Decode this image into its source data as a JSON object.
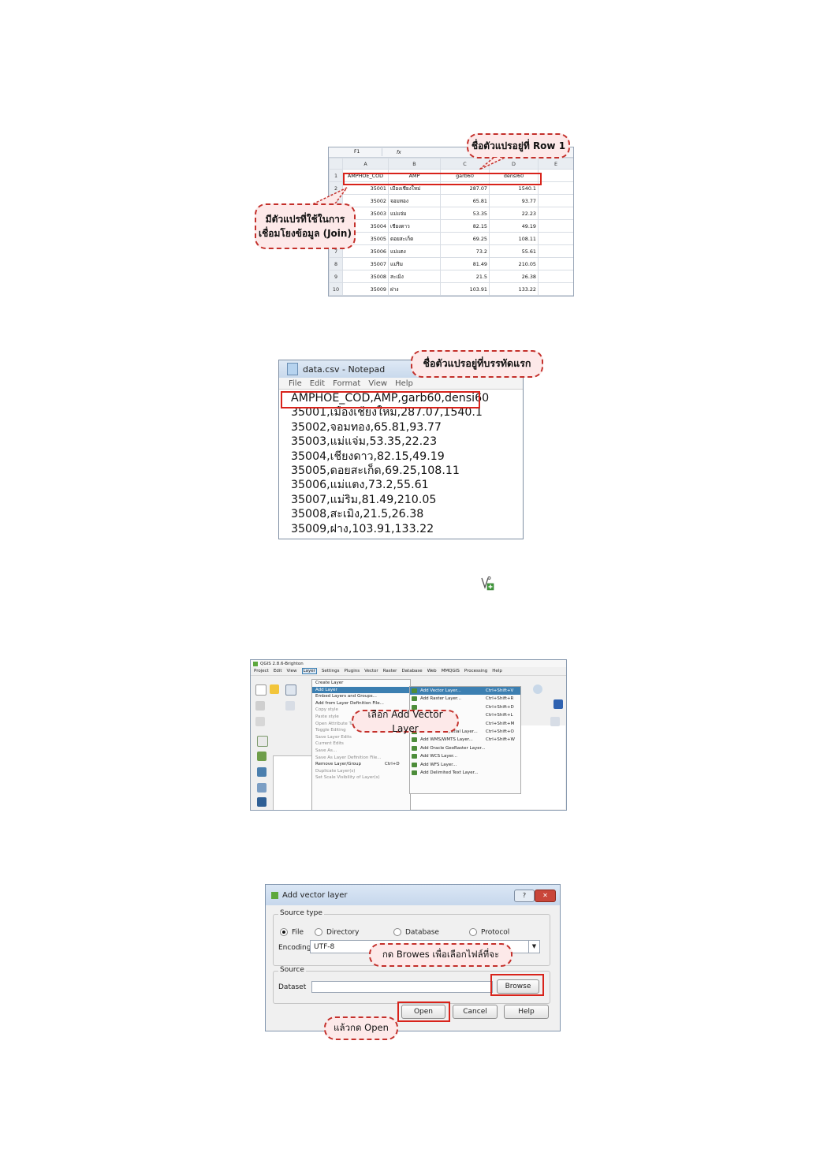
{
  "excel": {
    "namebox": "F1",
    "fx": "fx",
    "columns": [
      "",
      "A",
      "B",
      "C",
      "D",
      "E"
    ],
    "rows": [
      {
        "n": "1",
        "a": "AMPHOE_COD",
        "b": "AMP",
        "c": "garb60",
        "d": "densi60"
      },
      {
        "n": "2",
        "a": "35001",
        "b": "เมืองเชียงใหม่",
        "c": "287.07",
        "d": "1540.1"
      },
      {
        "n": "3",
        "a": "35002",
        "b": "จอมทอง",
        "c": "65.81",
        "d": "93.77"
      },
      {
        "n": "4",
        "a": "35003",
        "b": "แม่แจ่ม",
        "c": "53.35",
        "d": "22.23"
      },
      {
        "n": "5",
        "a": "35004",
        "b": "เชียงดาว",
        "c": "82.15",
        "d": "49.19"
      },
      {
        "n": "6",
        "a": "35005",
        "b": "ดอยสะเก็ด",
        "c": "69.25",
        "d": "108.11"
      },
      {
        "n": "7",
        "a": "35006",
        "b": "แม่แตง",
        "c": "73.2",
        "d": "55.61"
      },
      {
        "n": "8",
        "a": "35007",
        "b": "แม่ริม",
        "c": "81.49",
        "d": "210.05"
      },
      {
        "n": "9",
        "a": "35008",
        "b": "สะเมิง",
        "c": "21.5",
        "d": "26.38"
      },
      {
        "n": "10",
        "a": "35009",
        "b": "ฝาง",
        "c": "103.91",
        "d": "133.22"
      }
    ],
    "callout_row1": "ชื่อตัวแปรอยู่ที่ Row 1",
    "callout_join_line1": "มีตัวแปรที่ใช้ในการ",
    "callout_join_line2": "เชื่อมโยงข้อมูล (Join)"
  },
  "notepad": {
    "title": "data.csv - Notepad",
    "menu": [
      "File",
      "Edit",
      "Format",
      "View",
      "Help"
    ],
    "lines": [
      "AMPHOE_COD,AMP,garb60,densi60",
      "35001,เมืองเชียงใหม่,287.07,1540.1",
      "35002,จอมทอง,65.81,93.77",
      "35003,แม่แจ่ม,53.35,22.23",
      "35004,เชียงดาว,82.15,49.19",
      "35005,ดอยสะเก็ด,69.25,108.11",
      "35006,แม่แตง,73.2,55.61",
      "35007,แม่ริม,81.49,210.05",
      "35008,สะเมิง,21.5,26.38",
      "35009,ฝาง,103.91,133.22"
    ],
    "callout": "ชื่อตัวแปรอยู่ที่บรรทัดแรก"
  },
  "standalone_icon": "add-vector-layer-icon",
  "qgis": {
    "title": "QGIS 2.8.6-Brighton",
    "menubar": [
      "Project",
      "Edit",
      "View",
      "Layer",
      "Settings",
      "Plugins",
      "Vector",
      "Raster",
      "Database",
      "Web",
      "MMQGIS",
      "Processing",
      "Help"
    ],
    "layer_menu": [
      {
        "label": "Create Layer",
        "shortcut": "",
        "state": "normal"
      },
      {
        "label": "Add Layer",
        "shortcut": "",
        "state": "highlight"
      },
      {
        "label": "Embed Layers and Groups...",
        "shortcut": "",
        "state": "normal"
      },
      {
        "label": "Add from Layer Definition File...",
        "shortcut": "",
        "state": "normal"
      },
      {
        "label": "Copy style",
        "shortcut": "",
        "state": "disabled"
      },
      {
        "label": "Paste style",
        "shortcut": "",
        "state": "disabled"
      },
      {
        "label": "Open Attribute Table",
        "shortcut": "",
        "state": "disabled"
      },
      {
        "label": "Toggle Editing",
        "shortcut": "",
        "state": "disabled"
      },
      {
        "label": "Save Layer Edits",
        "shortcut": "",
        "state": "disabled"
      },
      {
        "label": "Current Edits",
        "shortcut": "",
        "state": "disabled"
      },
      {
        "label": "Save As...",
        "shortcut": "",
        "state": "disabled"
      },
      {
        "label": "Save As Layer Definition File...",
        "shortcut": "",
        "state": "disabled"
      },
      {
        "label": "Remove Layer/Group",
        "shortcut": "Ctrl+D",
        "state": "normal"
      },
      {
        "label": "Duplicate Layer(s)",
        "shortcut": "",
        "state": "disabled"
      },
      {
        "label": "Set Scale Visibility of Layer(s)",
        "shortcut": "",
        "state": "disabled"
      }
    ],
    "add_layer_submenu": [
      {
        "label": "Add Vector Layer...",
        "shortcut": "Ctrl+Shift+V",
        "state": "highlight"
      },
      {
        "label": "Add Raster Layer...",
        "shortcut": "Ctrl+Shift+R",
        "state": "normal"
      },
      {
        "label": "",
        "shortcut": "Ctrl+Shift+D",
        "state": "normal"
      },
      {
        "label": "",
        "shortcut": "Ctrl+Shift+L",
        "state": "normal"
      },
      {
        "label": "",
        "shortcut": "Ctrl+Shift+M",
        "state": "normal"
      },
      {
        "label": "Add Oracle Spatial Layer...",
        "shortcut": "Ctrl+Shift+O",
        "state": "normal"
      },
      {
        "label": "Add WMS/WMTS Layer...",
        "shortcut": "Ctrl+Shift+W",
        "state": "normal"
      },
      {
        "label": "Add Oracle GeoRaster Layer...",
        "shortcut": "",
        "state": "normal"
      },
      {
        "label": "Add WCS Layer...",
        "shortcut": "",
        "state": "normal"
      },
      {
        "label": "Add WFS Layer...",
        "shortcut": "",
        "state": "normal"
      },
      {
        "label": "Add Delimited Text Layer...",
        "shortcut": "",
        "state": "normal"
      }
    ],
    "callout": "เลือก Add Vector Layer",
    "colors": {
      "highlight": "#3c7fb1"
    }
  },
  "dialog": {
    "title": "Add vector layer",
    "help_glyph": "?",
    "close_glyph": "✕",
    "source_type_label": "Source type",
    "radios": [
      {
        "label": "File",
        "checked": true
      },
      {
        "label": "Directory",
        "checked": false
      },
      {
        "label": "Database",
        "checked": false
      },
      {
        "label": "Protocol",
        "checked": false
      }
    ],
    "encoding_label": "Encoding",
    "encoding_value": "UTF-8",
    "source_label": "Source",
    "dataset_label": "Dataset",
    "dataset_value": "",
    "browse_label": "Browse",
    "open_label": "Open",
    "cancel_label": "Cancel",
    "help_label": "Help",
    "callout_browse": "กด Browes เพื่อเลือกไฟล์ที่จะ",
    "callout_open": "แล้วกด Open"
  }
}
